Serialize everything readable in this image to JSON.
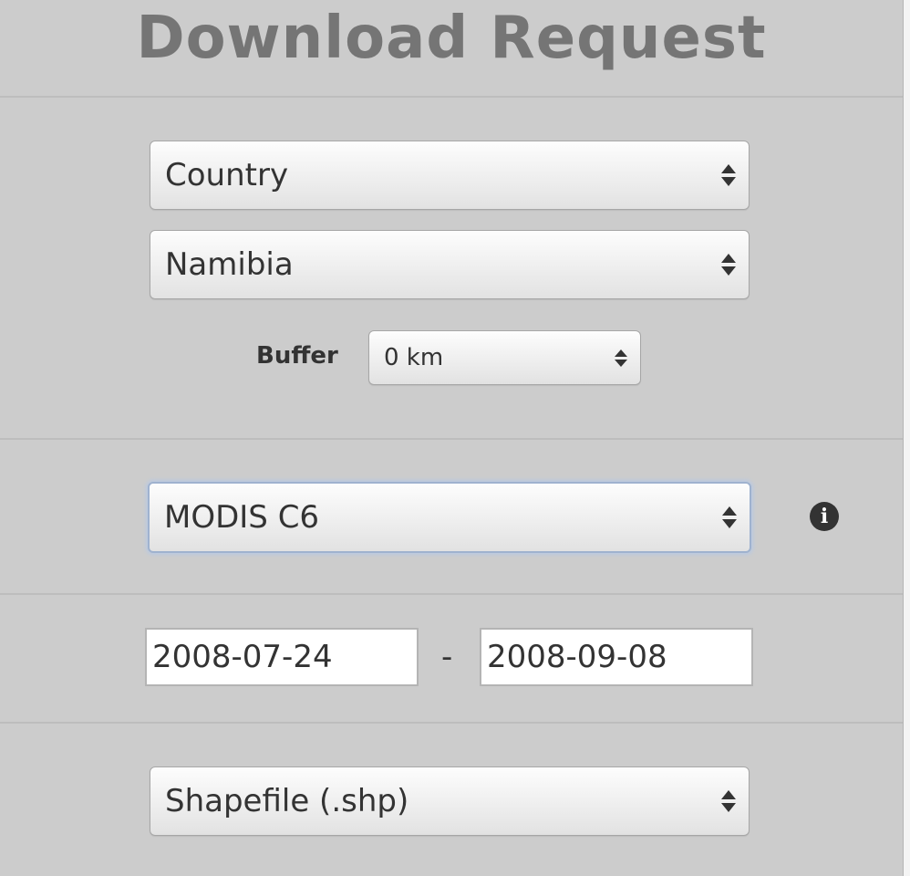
{
  "header": {
    "title": "Download Request"
  },
  "area": {
    "region_type": {
      "selected": "Country"
    },
    "region": {
      "selected": "Namibia"
    },
    "buffer": {
      "label": "Buffer",
      "selected": "0 km"
    }
  },
  "dataset": {
    "selected": "MODIS C6",
    "info_icon": "info-icon"
  },
  "date_range": {
    "start": "2008-07-24",
    "separator": "-",
    "end": "2008-09-08"
  },
  "format": {
    "selected": "Shapefile (.shp)"
  }
}
